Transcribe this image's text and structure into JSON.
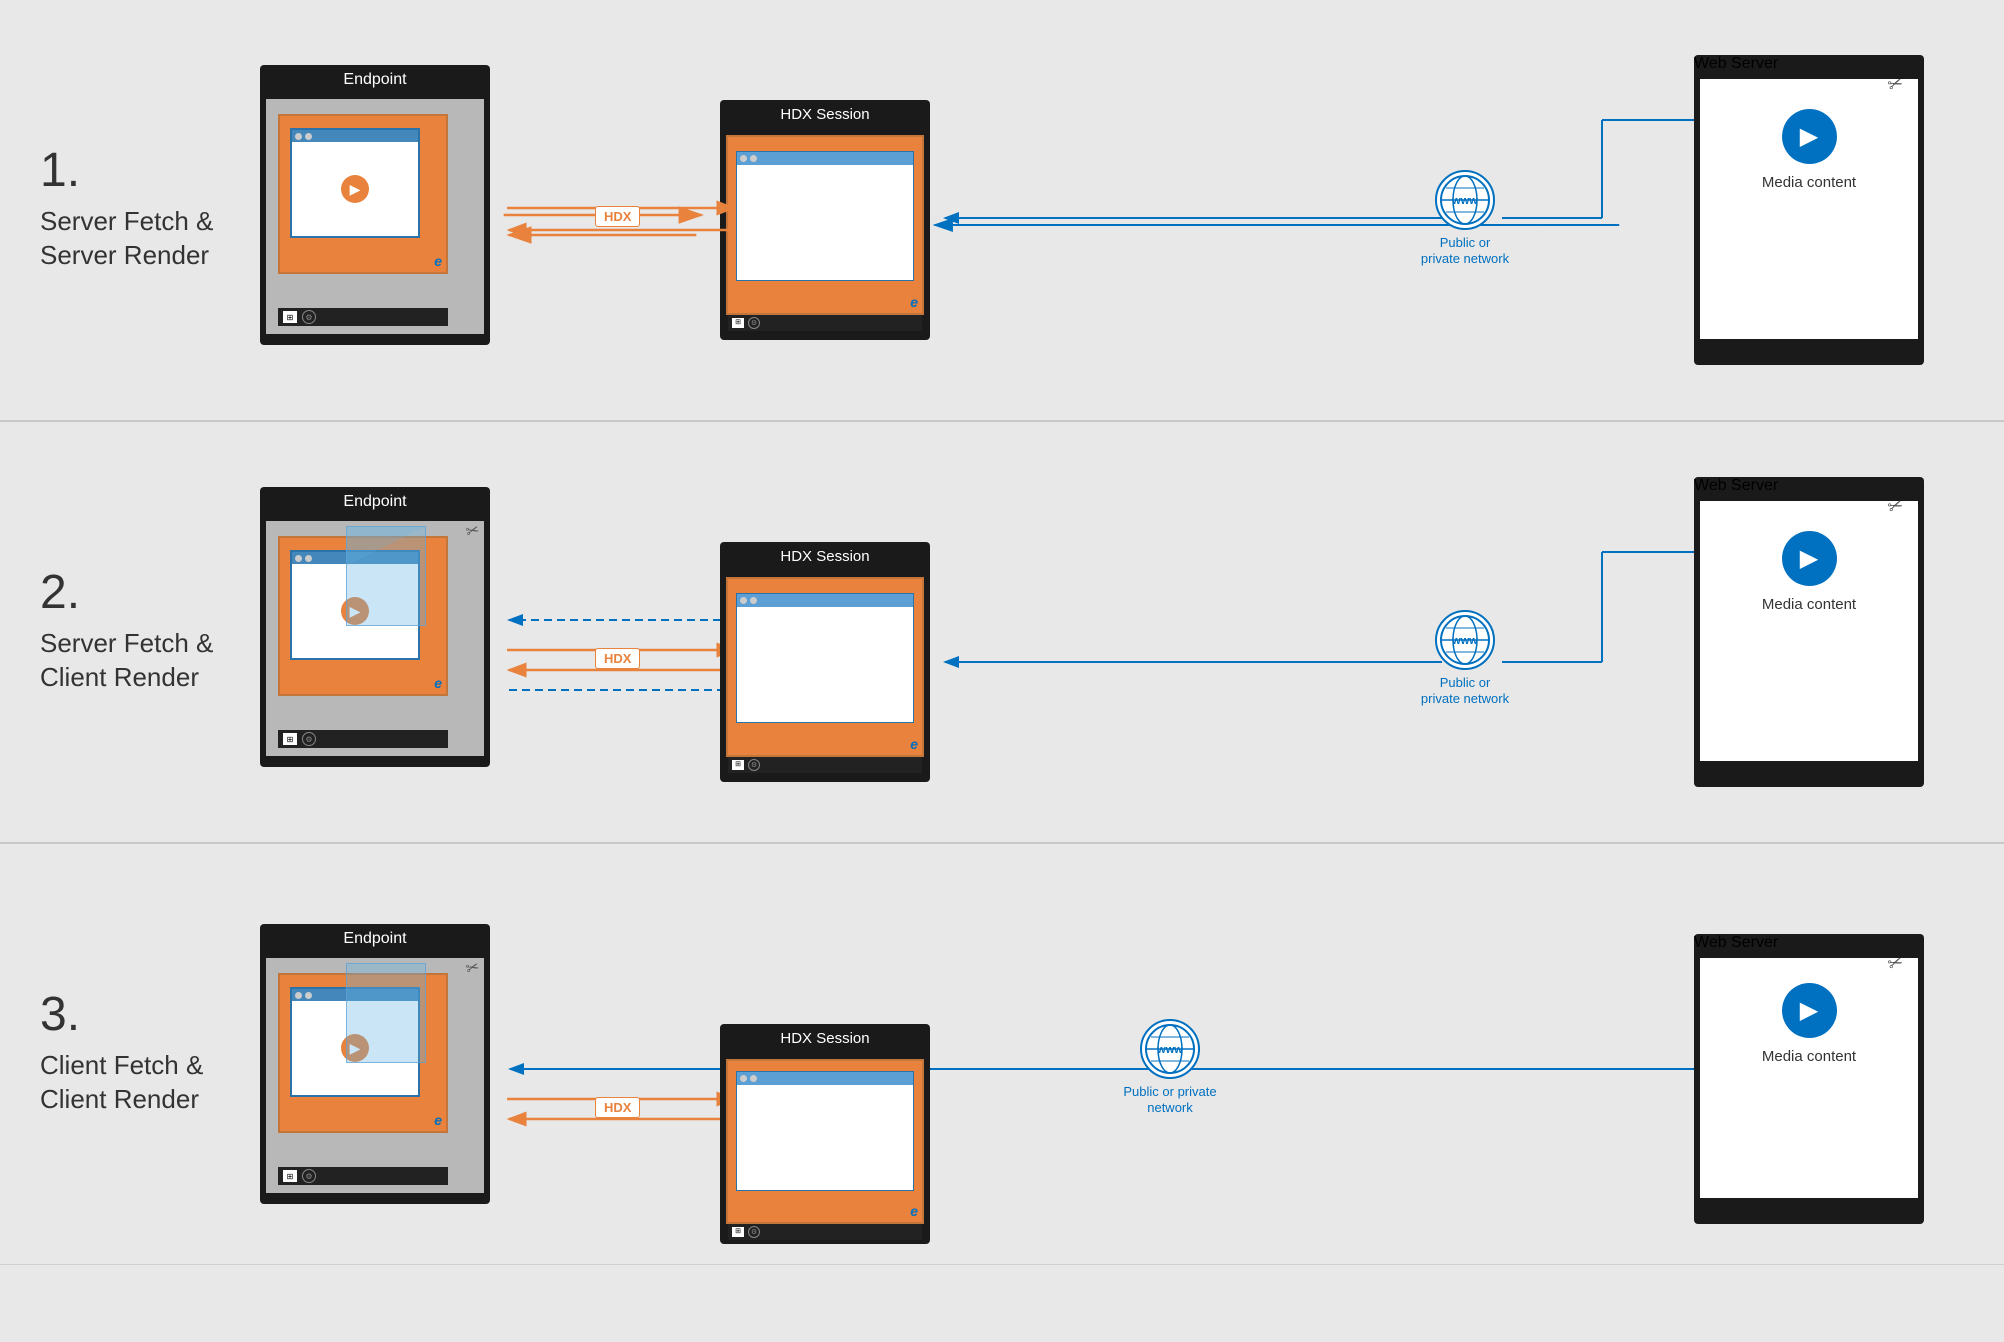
{
  "sections": [
    {
      "number": "1.",
      "title": "Server Fetch &\nServer Render",
      "endpoint_label": "Endpoint",
      "hdx_label": "HDX Session",
      "webserver_label": "Web Server",
      "media_label": "Media\ncontent",
      "network_label": "Public or private\nnetwork",
      "hdx_badge": "HDX",
      "scenario": "server-fetch-server-render"
    },
    {
      "number": "2.",
      "title": "Server Fetch &\nClient Render",
      "endpoint_label": "Endpoint",
      "hdx_label": "HDX Session",
      "webserver_label": "Web Server",
      "media_label": "Media\ncontent",
      "network_label": "Public or private\nnetwork",
      "hdx_badge": "HDX",
      "scenario": "server-fetch-client-render"
    },
    {
      "number": "3.",
      "title": "Client Fetch &\nClient Render",
      "endpoint_label": "Endpoint",
      "hdx_label": "HDX Session",
      "webserver_label": "Web Server",
      "media_label": "Media\ncontent",
      "network_label": "Public or private\nnetwork",
      "hdx_badge": "HDX",
      "scenario": "client-fetch-client-render"
    }
  ],
  "colors": {
    "orange": "#e8823c",
    "blue": "#0070c0",
    "light_blue": "#5b9fd4",
    "dark": "#1a1a1a",
    "bg": "#e8e8e8"
  }
}
